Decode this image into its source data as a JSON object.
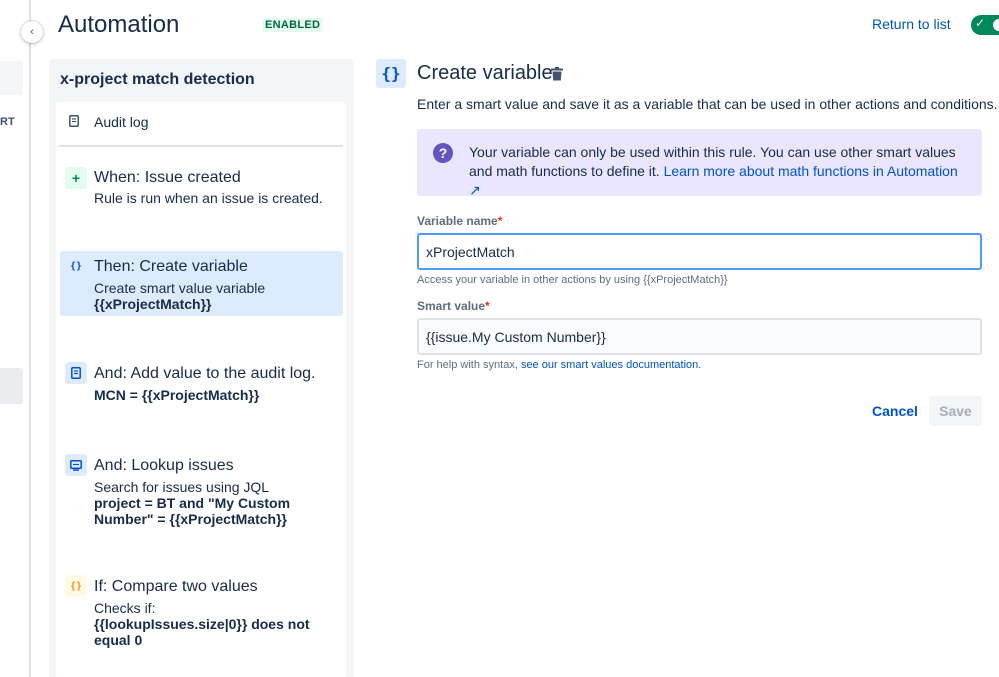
{
  "header": {
    "title": "Automation",
    "status": "ENABLED",
    "return_link": "Return to list",
    "toggle_on": true,
    "toggle_color": "#00875a"
  },
  "sidebar_edge": {
    "collapse_icon": "chevron-left-icon",
    "partial_text": "RT"
  },
  "rule": {
    "name": "x-project match detection",
    "audit_log": "Audit log",
    "steps": [
      {
        "icon": "plus-icon",
        "icon_glyph": "+",
        "title": "When: Issue created",
        "desc": "Rule is run when an issue is created.",
        "bold": ""
      },
      {
        "icon": "variable-icon",
        "icon_glyph": "{}",
        "title": "Then: Create variable",
        "desc": "Create smart value variable",
        "bold": "{{xProjectMatch}}",
        "selected": true
      },
      {
        "icon": "document-icon",
        "icon_glyph": "",
        "title": "And: Add value to the audit log.",
        "desc": "",
        "bold": "MCN = {{xProjectMatch}}"
      },
      {
        "icon": "lookup-icon",
        "icon_glyph": "",
        "title": "And: Lookup issues",
        "desc": "Search for issues using JQL",
        "bold": "project = BT and \"My Custom Number\" = {{xProjectMatch}}"
      },
      {
        "icon": "condition-icon",
        "icon_glyph": "{}",
        "title": "If: Compare two values",
        "desc": "Checks if:",
        "bold": "{{lookupIssues.size|0}} does not equal 0"
      }
    ]
  },
  "editor": {
    "icon": "variable-icon",
    "icon_glyph": "{}",
    "title": "Create variable",
    "delete_icon": "trash-icon",
    "description": "Enter a smart value and save it as a variable that can be used in other actions and conditions.",
    "info": {
      "icon": "question-icon",
      "icon_glyph": "?",
      "text": "Your variable can only be used within this rule. You can use other smart values and math functions to define it.",
      "link": "Learn more about math functions in Automation ↗"
    },
    "variable_name": {
      "label": "Variable name",
      "required_mark": "*",
      "value": "xProjectMatch",
      "helper": "Access your variable in other actions by using {{xProjectMatch}}"
    },
    "smart_value": {
      "label": "Smart value",
      "required_mark": "*",
      "value": "{{issue.My Custom Number}}",
      "helper_prefix": "For help with syntax,",
      "helper_link": "see our smart values documentation."
    },
    "cancel_label": "Cancel",
    "save_label": "Save"
  }
}
